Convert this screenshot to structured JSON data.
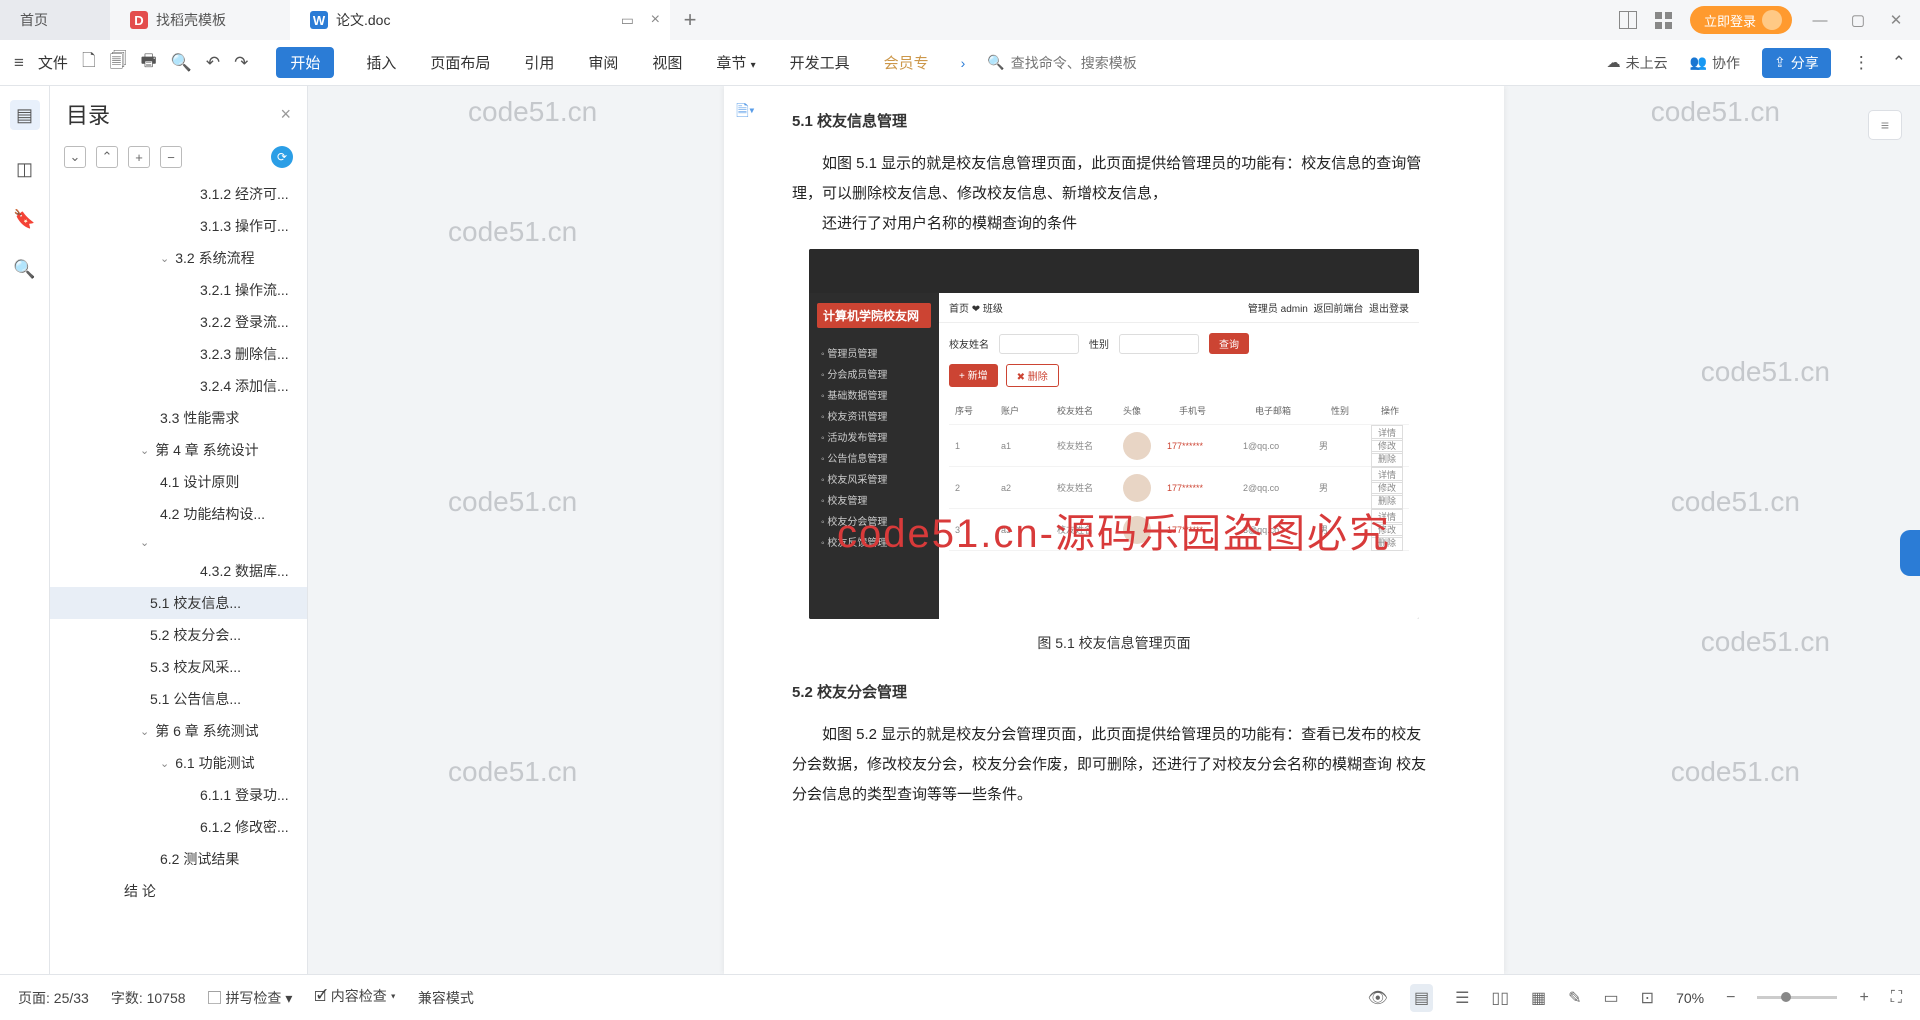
{
  "tabs": {
    "home": "首页",
    "template": "找稻壳模板",
    "doc": "论文.doc"
  },
  "title_right": {
    "login": "立即登录"
  },
  "toolbar": {
    "file": "文件",
    "menu": {
      "start": "开始",
      "insert": "插入",
      "layout": "页面布局",
      "ref": "引用",
      "review": "审阅",
      "view": "视图",
      "chapter": "章节",
      "dev": "开发工具",
      "vip": "会员专"
    },
    "search_ph": "查找命令、搜索模板",
    "cloud": "未上云",
    "collab": "协作",
    "share": "分享"
  },
  "outline": {
    "title": "目录",
    "items": [
      {
        "cls": "d2",
        "t": "3.1.2  经济可..."
      },
      {
        "cls": "d2",
        "t": "3.1.3  操作可..."
      },
      {
        "cls": "d0",
        "t": "3.2  系统流程",
        "chev": 1
      },
      {
        "cls": "d2",
        "t": "3.2.1  操作流..."
      },
      {
        "cls": "d2",
        "t": "3.2.2  登录流..."
      },
      {
        "cls": "d2",
        "t": "3.2.3  删除信..."
      },
      {
        "cls": "d2",
        "t": "3.2.4  添加信..."
      },
      {
        "cls": "d0",
        "t": "3.3  性能需求"
      },
      {
        "cls": "dc",
        "t": "第 4 章  系统设计",
        "chev": 1
      },
      {
        "cls": "d0",
        "t": "4.1  设计原则"
      },
      {
        "cls": "d0",
        "t": "4.2  功能结构设..."
      },
      {
        "cls": "dc",
        "t": "",
        "chev": 1
      },
      {
        "cls": "d2",
        "t": "4.3.2  数据库..."
      },
      {
        "cls": "d1",
        "t": "5.1  校友信息...",
        "active": 1
      },
      {
        "cls": "d1",
        "t": "5.2  校友分会..."
      },
      {
        "cls": "d1",
        "t": "5.3  校友风采..."
      },
      {
        "cls": "d1",
        "t": "5.1  公告信息..."
      },
      {
        "cls": "dc",
        "t": "第 6 章  系统测试",
        "chev": 1
      },
      {
        "cls": "d0",
        "t": "6.1  功能测试",
        "chev": 1
      },
      {
        "cls": "d2",
        "t": "6.1.1  登录功..."
      },
      {
        "cls": "d2",
        "t": "6.1.2  修改密..."
      },
      {
        "cls": "d0",
        "t": "6.2  测试结果"
      },
      {
        "cls": "dr",
        "t": "结   论"
      }
    ]
  },
  "doc": {
    "h51": "5.1  校友信息管理",
    "p51a": "如图 5.1 显示的就是校友信息管理页面，此页面提供给管理员的功能有：校友信息的查询管理，可以删除校友信息、修改校友信息、新增校友信息，",
    "p51b": "还进行了对用户名称的模糊查询的条件",
    "cap": "图 5.1  校友信息管理页面",
    "h52": "5.2  校友分会管理",
    "p52": "如图 5.2 显示的就是校友分会管理页面，此页面提供给管理员的功能有：查看已发布的校友分会数据，修改校友分会，校友分会作废，即可删除，还进行了对校友分会名称的模糊查询  校友分会信息的类型查询等等一些条件。",
    "shot": {
      "title": "计算机学院校友网",
      "admin": "管理员 admin",
      "back": "返回前端台",
      "logout": "退出登录",
      "crumb": "首页 ❤ 班级",
      "l_name": "校友姓名",
      "l_sex": "性别",
      "search": "查询",
      "add": "+ 新增",
      "del": "✖ 删除",
      "h_idx": "序号",
      "h_acc": "账户",
      "h_name": "校友姓名",
      "h_avatar": "头像",
      "h_phone": "手机号",
      "h_email": "电子邮箱",
      "h_sex": "性别",
      "h_op": "操作",
      "op_detail": "详情",
      "op_edit": "修改",
      "op_del": "删除",
      "side": [
        "管理员管理",
        "分会成员管理",
        "基础数据管理",
        "校友资讯管理",
        "活动发布管理",
        "公告信息管理",
        "校友风采管理",
        "校友管理",
        "校友分会管理",
        "校友反馈管理"
      ]
    }
  },
  "watermark": {
    "grey": "code51.cn",
    "red": "code51.cn-源码乐园盗图必究"
  },
  "status": {
    "page": "页面: 25/33",
    "words": "字数: 10758",
    "spell": "拼写检查",
    "content": "内容检查",
    "compat": "兼容模式",
    "zoom": "70%"
  }
}
